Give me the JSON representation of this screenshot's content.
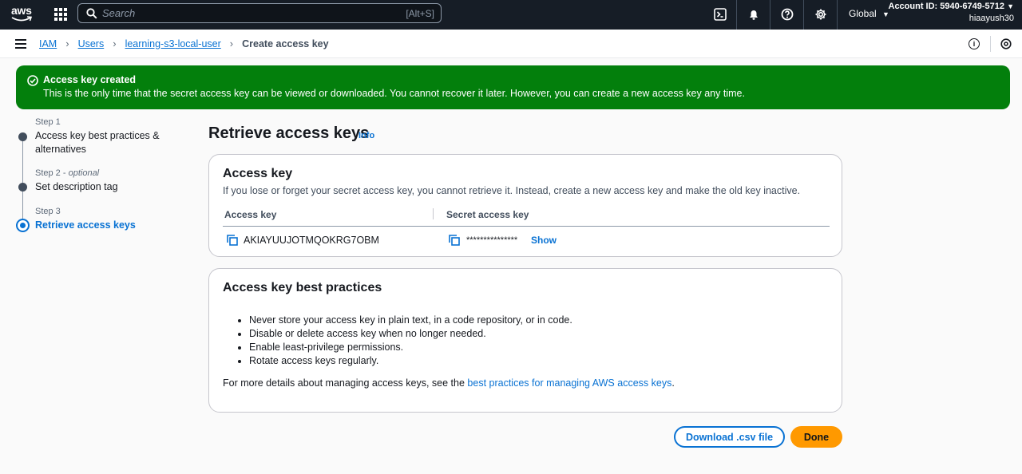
{
  "topnav": {
    "logo_text": "aws",
    "search_placeholder": "Search",
    "search_shortcut": "[Alt+S]",
    "region": "Global",
    "account_id": "Account ID: 5940-6749-5712",
    "username": "hiaayush30",
    "icons": [
      "cloudshell-icon",
      "bell-icon",
      "help-icon",
      "settings-icon"
    ]
  },
  "breadcrumb": {
    "items": [
      "IAM",
      "Users",
      "learning-s3-local-user"
    ],
    "current": "Create access key"
  },
  "flash": {
    "title": "Access key created",
    "message": "This is the only time that the secret access key can be viewed or downloaded. You cannot recover it later. However, you can create a new access key any time.",
    "color": "#037f0c"
  },
  "steps": [
    {
      "number": "Step 1",
      "optional": "",
      "label": "Access key best practices & alternatives",
      "state": "completed"
    },
    {
      "number": "Step 2",
      "optional": "optional",
      "label": "Set description tag",
      "state": "completed"
    },
    {
      "number": "Step 3",
      "optional": "",
      "label": "Retrieve access keys",
      "state": "active"
    }
  ],
  "main": {
    "title": "Retrieve access keys",
    "info": "Info"
  },
  "access_key_card": {
    "title": "Access key",
    "description": "If you lose or forget your secret access key, you cannot retrieve it. Instead, create a new access key and make the old key inactive.",
    "col_access_key": "Access key",
    "col_secret_key": "Secret access key",
    "access_key_value": "AKIAYUUJOTMQOKRG7OBM",
    "secret_key_value": "***************",
    "show_label": "Show"
  },
  "best_practices_card": {
    "title": "Access key best practices",
    "items": [
      "Never store your access key in plain text, in a code repository, or in code.",
      "Disable or delete access key when no longer needed.",
      "Enable least-privilege permissions.",
      "Rotate access keys regularly."
    ],
    "more_prefix": "For more details about managing access keys, see the ",
    "more_link": "best practices for managing AWS access keys",
    "more_suffix": "."
  },
  "actions": {
    "download_label": "Download .csv file",
    "done_label": "Done"
  },
  "colors": {
    "link": "#0972d3",
    "primary_button": "#ff9900",
    "nav_bg": "#161d26"
  }
}
